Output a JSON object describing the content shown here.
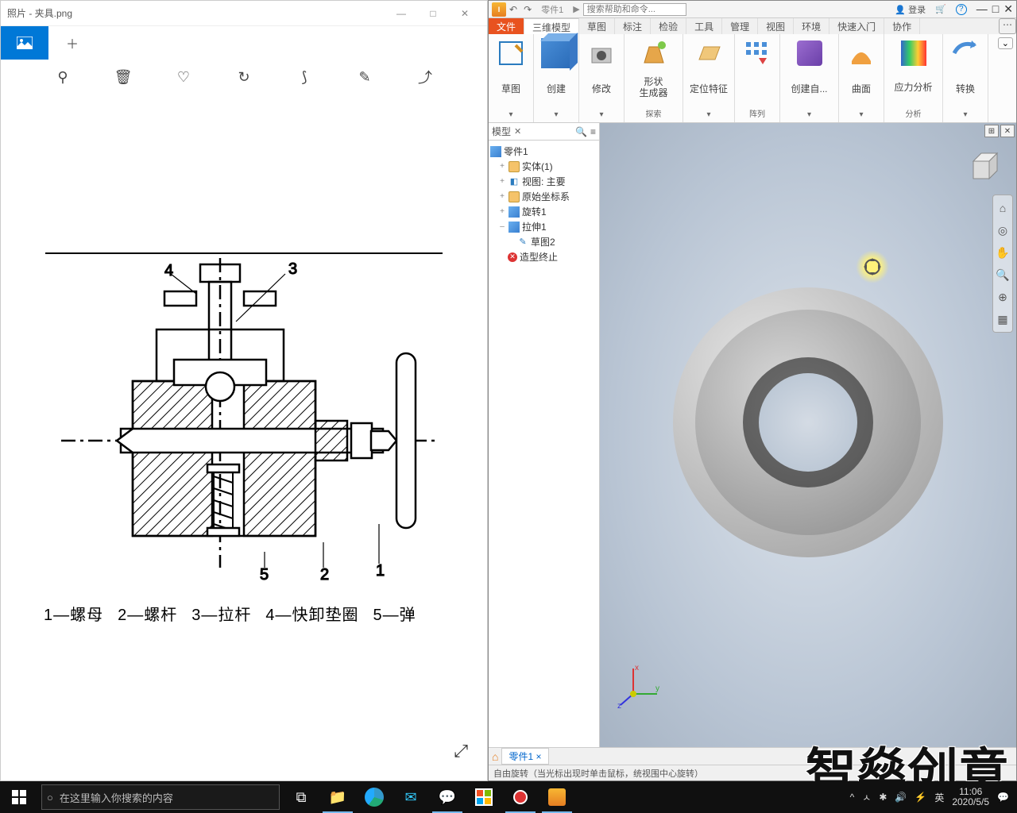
{
  "photos": {
    "title": "照片 - 夹具.png",
    "tabs": {
      "image_tab_glyph": "▢",
      "add_tab_glyph": "＋"
    },
    "tools": {
      "zoom": "⚲",
      "delete": "🗑",
      "heart": "♡",
      "rotate": "↻",
      "crop": "⟆",
      "edit": "✎",
      "share": "⤴"
    },
    "caption_parts": {
      "p1": "1—螺母",
      "p2": "2—螺杆",
      "p3": "3—拉杆",
      "p4": "4—快卸垫圈",
      "p5": "5—弹"
    },
    "callouts": {
      "c1": "1",
      "c2": "2",
      "c3": "3",
      "c4": "4",
      "c5": "5"
    },
    "expand_glyph": "⤢"
  },
  "inventor": {
    "doc_name": "零件1",
    "search_placeholder": "搜索帮助和命令...",
    "login_label": "登录",
    "qat": {
      "undo": "↶",
      "redo": "↷"
    },
    "tabs": {
      "file": "文件",
      "model": "三维模型",
      "sketch": "草图",
      "annotate": "标注",
      "inspect": "检验",
      "tools": "工具",
      "manage": "管理",
      "view": "视图",
      "env": "环境",
      "getstarted": "快速入门",
      "collab": "协作"
    },
    "panels": {
      "sketch": {
        "label": "草图"
      },
      "create": {
        "label": "创建"
      },
      "modify": {
        "label": "修改"
      },
      "shapegen": {
        "label": "形状\n生成器"
      },
      "explore": {
        "bottom": "探索"
      },
      "workfeat": {
        "label": "定位特征"
      },
      "pattern": {
        "label": "阵列",
        "bottom": "阵列"
      },
      "freeform": {
        "label": "创建自..."
      },
      "surface": {
        "label": "曲面"
      },
      "stress": {
        "label": "应力分析",
        "bottom": "分析"
      },
      "convert": {
        "label": "转换"
      }
    },
    "browser": {
      "tab": "模型",
      "root": "零件1",
      "nodes": {
        "solids": "实体(1)",
        "view": "视图: 主要",
        "origin": "原始坐标系",
        "rev": "旋转1",
        "ext": "拉伸1",
        "sk": "草图2",
        "end": "造型终止"
      }
    },
    "doc_tab": "零件1 ×",
    "status": "自由旋转（当光标出现时单击鼠标，统视围中心旋转）",
    "triad": {
      "x": "x",
      "y": "y",
      "z": "z"
    }
  },
  "watermark": "智燊创意",
  "taskbar": {
    "search_placeholder": "在这里输入你搜索的内容",
    "ime": "英",
    "time": "11:06",
    "date": "2020/5/5",
    "tray": {
      "up": "^",
      "user": "ㅅ",
      "net": "✱",
      "vol": "🔊",
      "batt": "⚡"
    }
  }
}
